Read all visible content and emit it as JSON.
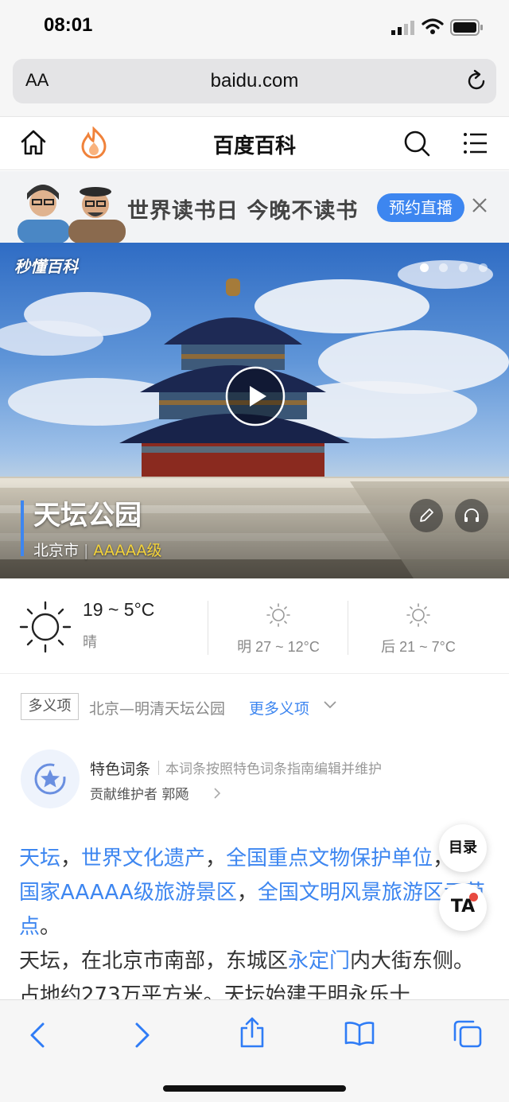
{
  "status_bar": {
    "time": "08:01"
  },
  "browser": {
    "text_size_label": "AA",
    "url": "baidu.com"
  },
  "header": {
    "title": "百度百科"
  },
  "banner": {
    "text": "世界读书日 今晚不读书",
    "button": "预约直播",
    "colors": {
      "button": "#3d86f0"
    }
  },
  "hero": {
    "brand": "秒懂百科",
    "title": "天坛公园",
    "city": "北京市",
    "separator": "|",
    "level": "AAAAA级",
    "slide_count": 4,
    "active_slide": 1
  },
  "weather": {
    "today_temp": "19 ~ 5°C",
    "today_desc": "晴",
    "tomorrow": "明 27 ~ 12°C",
    "day_after": "后 21 ~ 7°C"
  },
  "polysemy": {
    "tag": "多义项",
    "text": "北京—明清天坛公园",
    "more": "更多义项"
  },
  "special_entry": {
    "title": "特色词条",
    "desc": "本词条按照特色词条指南编辑并维护",
    "contributor": "贡献维护者 郭飏"
  },
  "body": {
    "l1_link1": "天坛",
    "l1_sep1": "，",
    "l1_link2": "世界文化遗产",
    "l1_sep2": "，",
    "l1_link3": "全国重点文物保护单位",
    "l1_sep3": "，",
    "l2_link1": "国家AAAAA级旅游景区",
    "l2_sep1": "，",
    "l2_link2": "全国文明风景旅游区示范点",
    "l2_end": "。",
    "p2_start": "天坛，在北京市南部，东城区",
    "p2_link": "永定门",
    "p2_rest": "内大街东侧。占地约273万平方米。天坛始建于明永乐十"
  },
  "floating": {
    "toc": "目录",
    "ta": "TA"
  }
}
